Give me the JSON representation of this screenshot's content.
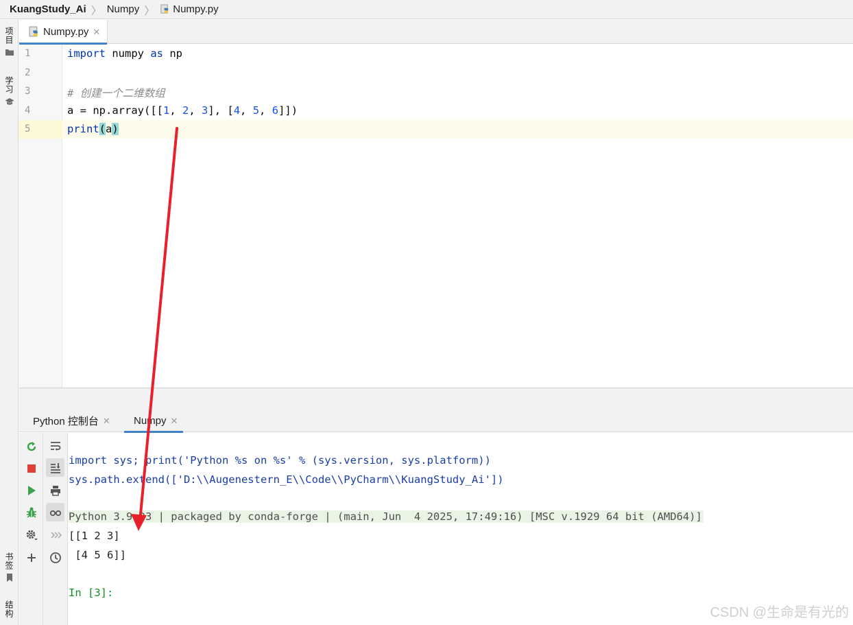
{
  "breadcrumb": {
    "project": "KuangStudy_Ai",
    "folder": "Numpy",
    "file": "Numpy.py"
  },
  "left_strip": {
    "project_label": "项目",
    "learn_label": "学习",
    "bookmarks_label": "书签",
    "structure_label": "结构"
  },
  "editor": {
    "tab_label": "Numpy.py",
    "line_numbers": [
      "1",
      "2",
      "3",
      "4",
      "5"
    ],
    "lines": {
      "l1": {
        "t1": "import",
        "t2": " numpy ",
        "t3": "as",
        "t4": " np"
      },
      "l3": {
        "t1": "# 创建一个二维数组"
      },
      "l4": {
        "t1": "a = np.array([[",
        "n1": "1",
        "s1": ", ",
        "n2": "2",
        "s2": ", ",
        "n3": "3",
        "s3": "], [",
        "n4": "4",
        "s4": ", ",
        "n5": "5",
        "s5": ", ",
        "n6": "6",
        "s6": "]])"
      },
      "l5": {
        "t1": "print",
        "p1": "(",
        "t2": "a",
        "p2": ")"
      }
    }
  },
  "run_window": {
    "tabs": [
      {
        "label": "Python 控制台"
      },
      {
        "label": "Numpy"
      }
    ],
    "console": {
      "cmd1": "import sys; print('Python %s on %s' % (sys.version, sys.platform))",
      "cmd2": "sys.path.extend(['D:\\\\Augenestern_E\\\\Code\\\\PyCharm\\\\KuangStudy_Ai'])",
      "banner": "Python 3.9.23 | packaged by conda-forge | (main, Jun  4 2025, 17:49:16) [MSC v.1929 64 bit (AMD64)]",
      "out1": "[[1 2 3]",
      "out2": " [4 5 6]]",
      "prompt": "In [3]:"
    }
  },
  "watermark": "CSDN @生命是有光的",
  "colors": {
    "accent": "#4083c9",
    "arrow": "#e8202a",
    "keyword": "#0033b3",
    "number": "#1750eb"
  }
}
